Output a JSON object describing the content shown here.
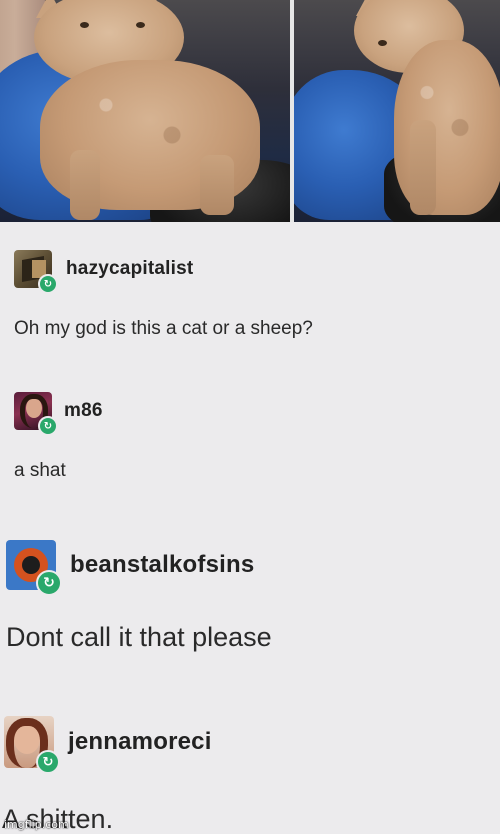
{
  "photos": {
    "left": {
      "subject": "curly-haired kitten on car seat"
    },
    "right": {
      "subject": "curly-haired kitten on car seat"
    }
  },
  "thread": [
    {
      "username": "hazycapitalist",
      "avatar_icon": "block-avatar-icon",
      "text": "Oh my god is this a cat or a sheep?"
    },
    {
      "username": "m86",
      "avatar_icon": "portrait-avatar-icon",
      "text": "a shat"
    },
    {
      "username": "beanstalkofsins",
      "avatar_icon": "vinyl-avatar-icon",
      "text": "Dont call it that please"
    },
    {
      "username": "jennamoreci",
      "avatar_icon": "portrait-avatar-icon",
      "text": "A shitten."
    }
  ],
  "reblog_icon": "reblog-icon",
  "watermark": "imgflip.com",
  "colors": {
    "background": "#ecebed",
    "reblog_badge": "#2aa86b",
    "text": "#2a2a2a"
  }
}
